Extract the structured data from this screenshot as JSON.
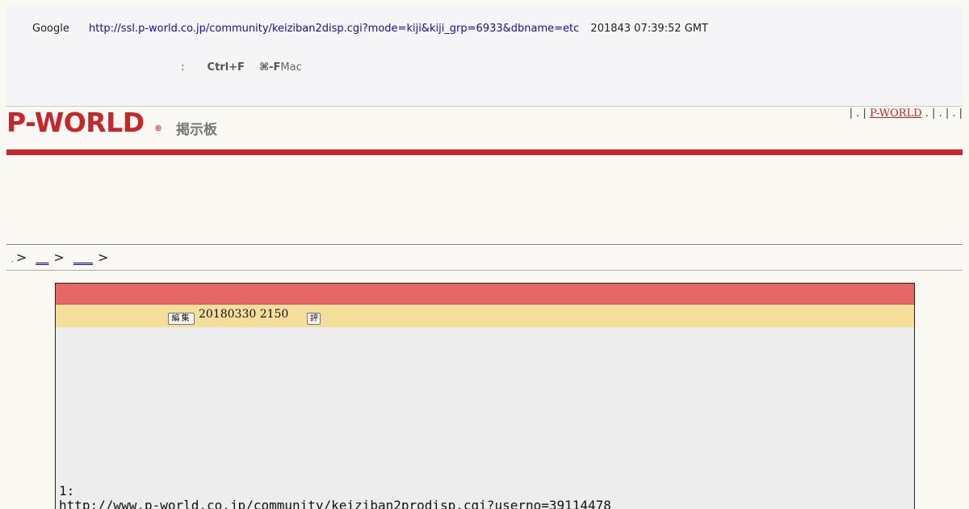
{
  "cache_banner": {
    "source_label": "Google",
    "url": "http://ssl.p-world.co.jp/community/keiziban2disp.cgi?mode=kiji&kiji_grp=6933&dbname=etc",
    "snapshot_date": "201843 07:39:52 GMT",
    "hint_colon": ":",
    "shortcut_win": "Ctrl+F",
    "shortcut_mac_key": "⌘-F",
    "shortcut_mac_label": "Mac"
  },
  "header": {
    "logo_text": "P-WORLD",
    "logo_mark": "®",
    "board_title": "掲示板",
    "links_prefix": "| . |",
    "link_pworld": "P-WORLD",
    "links_suffix": ". | . | . |"
  },
  "breadcrumb": {
    "dot": ".",
    "sep": ">",
    "link1": "__",
    "link2": "___",
    "tail": ">"
  },
  "thread": {
    "edit_button": "編集",
    "date": "20180330 2150",
    "rate_button": "評",
    "post_number": "1:",
    "post_link": "http://www.p-world.co.jp/community/keiziban2prodisp.cgi?userno=39114478"
  },
  "colors": {
    "brand_red": "#c9262c",
    "title_bar": "#e76767",
    "meta_bar": "#f3de9a",
    "link_blue": "#1a0dab"
  }
}
